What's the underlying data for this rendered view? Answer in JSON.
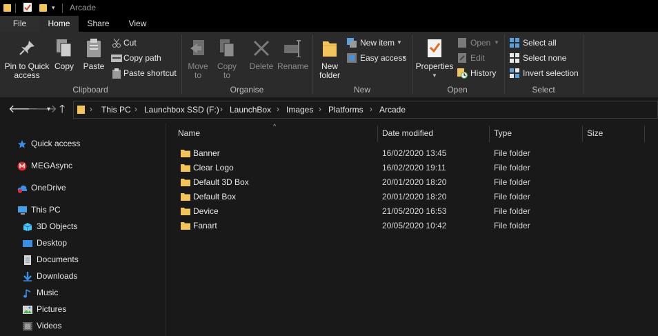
{
  "window": {
    "title": "Arcade"
  },
  "ribbon": {
    "tabs": [
      "File",
      "Home",
      "Share",
      "View"
    ],
    "clipboard": {
      "label": "Clipboard",
      "pin": "Pin to Quick access",
      "pin_line1": "Pin to Quick",
      "pin_line2": "access",
      "copy": "Copy",
      "paste": "Paste",
      "cut": "Cut",
      "copy_path": "Copy path",
      "paste_shortcut": "Paste shortcut"
    },
    "organise": {
      "label": "Organise",
      "move_to_1": "Move",
      "move_to_2": "to",
      "copy_to_1": "Copy",
      "copy_to_2": "to",
      "delete": "Delete",
      "rename": "Rename"
    },
    "new": {
      "label": "New",
      "new_folder_1": "New",
      "new_folder_2": "folder",
      "new_item": "New item",
      "easy_access": "Easy access"
    },
    "open": {
      "label": "Open",
      "properties": "Properties",
      "open": "Open",
      "edit": "Edit",
      "history": "History"
    },
    "select": {
      "label": "Select",
      "select_all": "Select all",
      "select_none": "Select none",
      "invert_selection": "Invert selection"
    }
  },
  "address": {
    "crumbs": [
      "This PC",
      "Launchbox SSD (F:)",
      "LaunchBox",
      "Images",
      "Platforms",
      "Arcade"
    ]
  },
  "navpane": {
    "items": [
      {
        "label": "Quick access",
        "icon": "star-icon"
      },
      {
        "label": "MEGAsync",
        "icon": "mega-icon"
      },
      {
        "label": "OneDrive",
        "icon": "cloud-icon"
      },
      {
        "label": "This PC",
        "icon": "computer-icon"
      },
      {
        "label": "3D Objects",
        "icon": "cube-icon"
      },
      {
        "label": "Desktop",
        "icon": "desktop-icon"
      },
      {
        "label": "Documents",
        "icon": "document-icon"
      },
      {
        "label": "Downloads",
        "icon": "download-icon"
      },
      {
        "label": "Music",
        "icon": "music-icon"
      },
      {
        "label": "Pictures",
        "icon": "picture-icon"
      },
      {
        "label": "Videos",
        "icon": "video-icon"
      }
    ]
  },
  "filelist": {
    "columns": {
      "name": "Name",
      "date": "Date modified",
      "type": "Type",
      "size": "Size"
    },
    "rows": [
      {
        "name": "Banner",
        "date": "16/02/2020 13:45",
        "type": "File folder"
      },
      {
        "name": "Clear Logo",
        "date": "16/02/2020 19:11",
        "type": "File folder"
      },
      {
        "name": "Default 3D Box",
        "date": "20/01/2020 18:20",
        "type": "File folder"
      },
      {
        "name": "Default Box",
        "date": "20/01/2020 18:20",
        "type": "File folder"
      },
      {
        "name": "Device",
        "date": "21/05/2020 16:53",
        "type": "File folder"
      },
      {
        "name": "Fanart",
        "date": "20/05/2020 10:42",
        "type": "File folder"
      }
    ]
  },
  "colors": {
    "folder": "#f2c55c",
    "accent": "#1e90ff",
    "background": "#191919",
    "ribbon": "#2b2b2b"
  }
}
